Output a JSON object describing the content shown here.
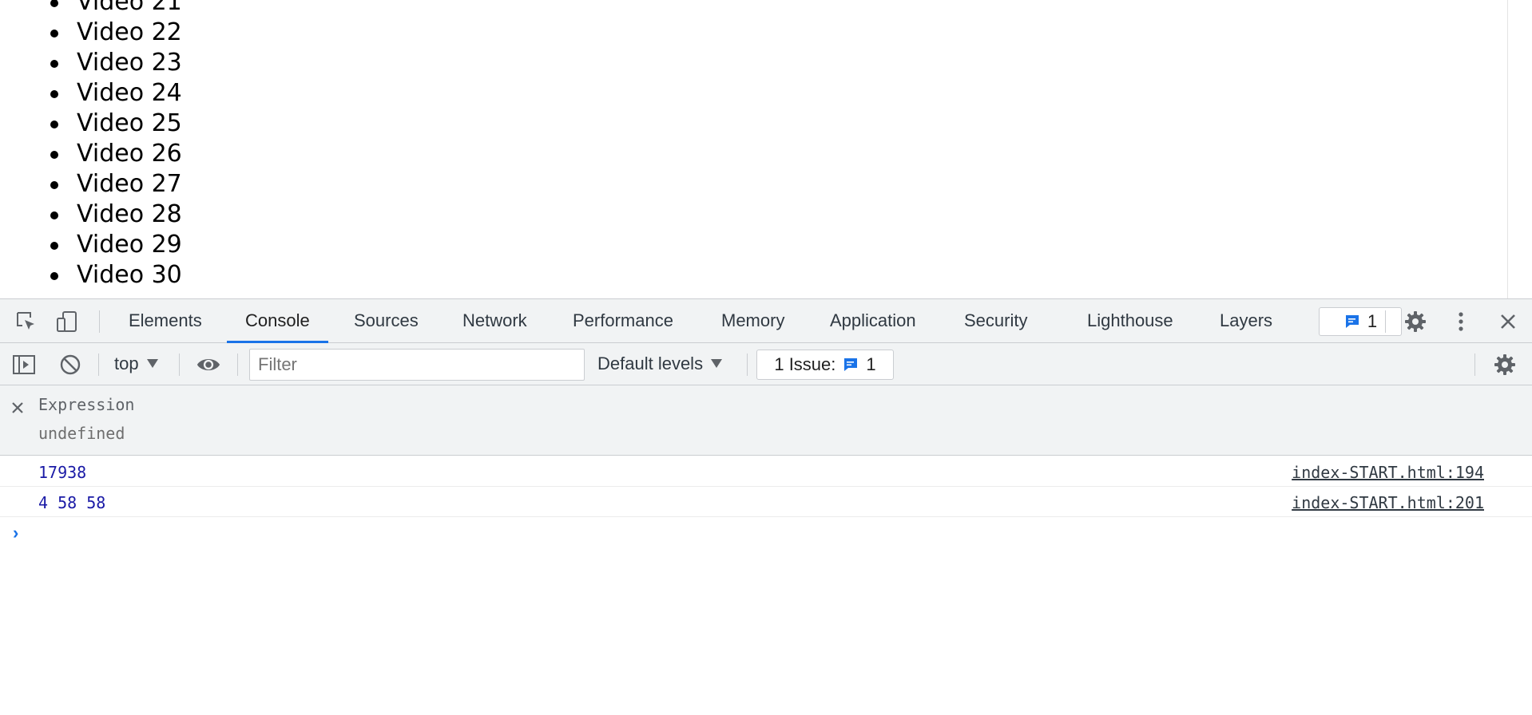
{
  "page": {
    "videos": [
      "Video 21",
      "Video 22",
      "Video 23",
      "Video 24",
      "Video 25",
      "Video 26",
      "Video 27",
      "Video 28",
      "Video 29",
      "Video 30"
    ]
  },
  "devtools": {
    "tabs": [
      {
        "label": "Elements"
      },
      {
        "label": "Console",
        "active": true
      },
      {
        "label": "Sources"
      },
      {
        "label": "Network"
      },
      {
        "label": "Performance"
      },
      {
        "label": "Memory"
      },
      {
        "label": "Application"
      },
      {
        "label": "Security"
      },
      {
        "label": "Lighthouse"
      },
      {
        "label": "Layers"
      }
    ],
    "issues_badge_count": "1",
    "icons": [
      "inspect-element-icon",
      "device-toolbar-icon",
      "issues-message-icon",
      "settings-gear-icon",
      "more-options-icon",
      "close-icon"
    ]
  },
  "console_toolbar": {
    "context": "top",
    "filter_placeholder": "Filter",
    "levels": "Default levels",
    "issue_label": "1 Issue:",
    "issue_count": "1",
    "icons": [
      "sidebar-toggle-icon",
      "clear-console-icon",
      "live-expression-eye-icon",
      "console-settings-gear-icon"
    ]
  },
  "live_expression": {
    "name": "Expression",
    "value": "undefined"
  },
  "messages": [
    {
      "text": "17938",
      "source": "index-START.html:194"
    },
    {
      "text": "4 58 58",
      "source": "index-START.html:201"
    }
  ],
  "prompt": "›",
  "colors": {
    "accent": "#1a73e8",
    "toolbar_bg": "#f1f3f4",
    "log_text": "#1a1aa6"
  }
}
